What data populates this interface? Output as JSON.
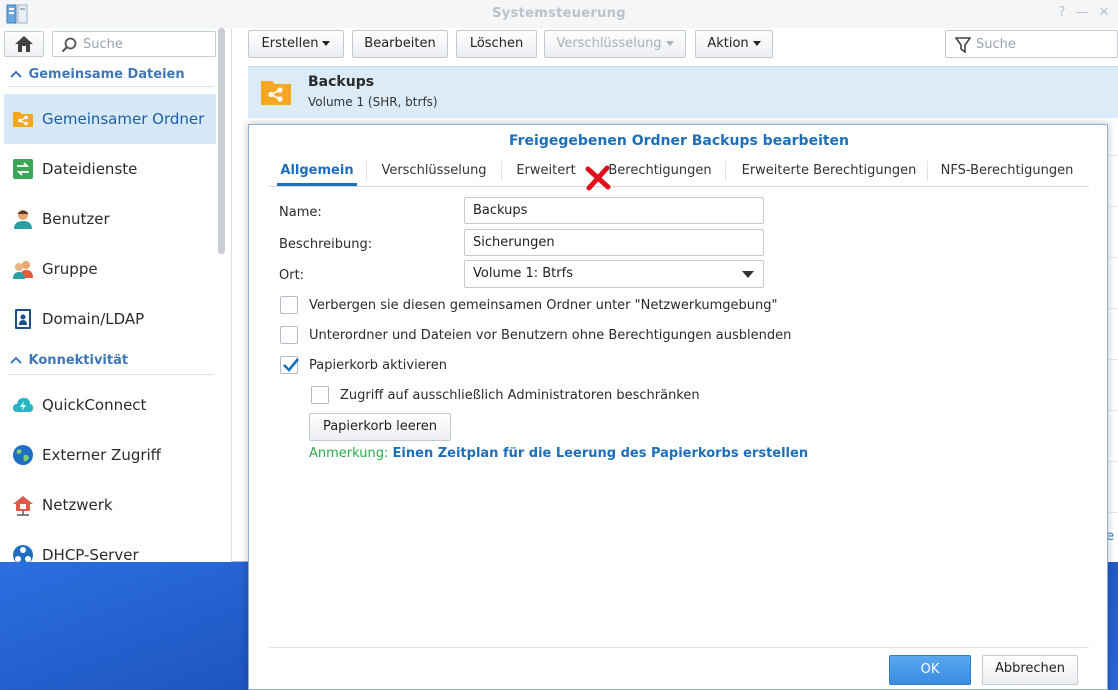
{
  "window": {
    "title": "Systemsteuerung",
    "help_glyph": "?",
    "minimize_glyph": "—",
    "close_glyph": "✕"
  },
  "sidebar": {
    "search_placeholder": "Suche",
    "groups": [
      {
        "label": "Gemeinsame Dateien",
        "expanded": true
      },
      {
        "label": "Konnektivität",
        "expanded": true
      }
    ],
    "items": [
      {
        "label": "Gemeinsamer Ordner",
        "icon": "shared-folder-icon",
        "active": true
      },
      {
        "label": "Dateidienste",
        "icon": "file-services-icon"
      },
      {
        "label": "Benutzer",
        "icon": "user-icon"
      },
      {
        "label": "Gruppe",
        "icon": "group-icon"
      },
      {
        "label": "Domain/LDAP",
        "icon": "domain-ldap-icon"
      },
      {
        "label": "QuickConnect",
        "icon": "quickconnect-cloud-icon"
      },
      {
        "label": "Externer Zugriff",
        "icon": "globe-icon"
      },
      {
        "label": "Netzwerk",
        "icon": "network-house-icon"
      },
      {
        "label": "DHCP-Server",
        "icon": "dhcp-server-icon"
      }
    ]
  },
  "toolbar": {
    "create": "Erstellen",
    "edit": "Bearbeiten",
    "delete": "Löschen",
    "encryption": "Verschlüsselung",
    "action": "Aktion",
    "search_placeholder": "Suche"
  },
  "list": {
    "selected": {
      "name": "Backups",
      "sub": "Volume 1 (SHR, btrfs)"
    },
    "partial_text": "e"
  },
  "dialog": {
    "title": "Freigegebenen Ordner Backups bearbeiten",
    "tabs": [
      "Allgemein",
      "Verschlüsselung",
      "Erweitert",
      "Berechtigungen",
      "Erweiterte Berechtigungen",
      "NFS-Berechtigungen"
    ],
    "active_tab": 0,
    "fields": {
      "name_label": "Name:",
      "name_value": "Backups",
      "desc_label": "Beschreibung:",
      "desc_value": "Sicherungen",
      "location_label": "Ort:",
      "location_value": "Volume 1:  Btrfs"
    },
    "checkboxes": [
      {
        "label": "Verbergen sie diesen gemeinsamen Ordner unter \"Netzwerkumgebung\"",
        "checked": false
      },
      {
        "label": "Unterordner und Dateien vor Benutzern ohne Berechtigungen ausblenden",
        "checked": false
      },
      {
        "label": "Papierkorb aktivieren",
        "checked": true
      },
      {
        "label": "Zugriff auf ausschließlich Administratoren beschränken",
        "checked": false
      }
    ],
    "empty_recycle": "Papierkorb leeren",
    "note_prefix": "Anmerkung:",
    "note_link": "Einen Zeitplan für die Leerung des Papierkorbs erstellen",
    "ok": "OK",
    "cancel": "Abbrechen"
  },
  "colors": {
    "accent": "#1d6fba",
    "folder": "#f5a623",
    "ok_button": "#3a8be0",
    "note_green": "#2aa84a",
    "annotation_x": "#e0101c"
  }
}
